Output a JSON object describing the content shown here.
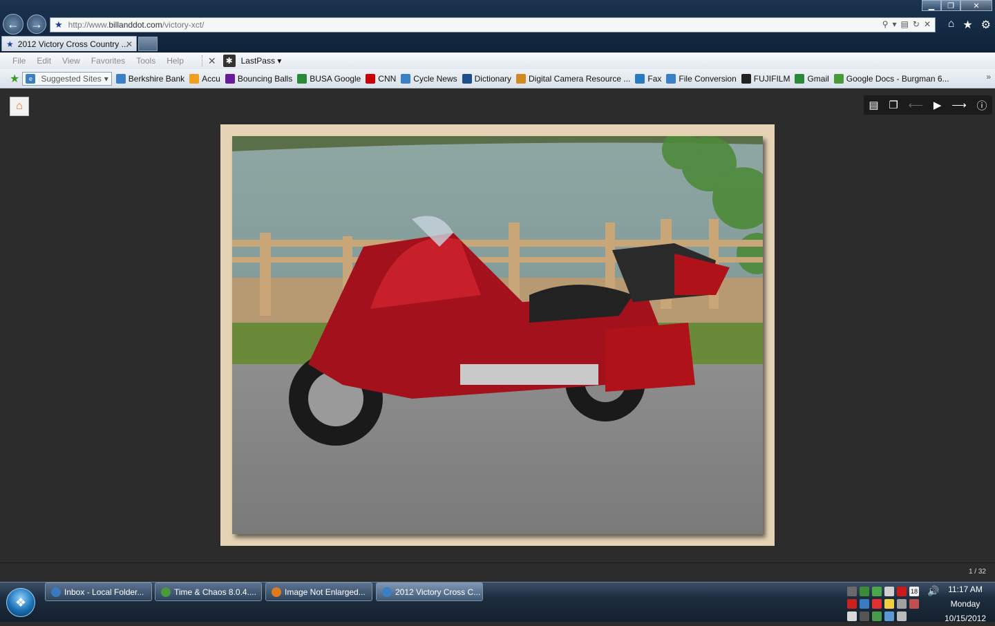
{
  "window": {
    "minimize_label": "▁",
    "restore_label": "❐",
    "close_label": "✕"
  },
  "address": {
    "url_prefix": "http://www.",
    "url_domain": "billanddot.com",
    "url_path": "/victory-xct/"
  },
  "tab": {
    "title": "2012 Victory Cross Country ..."
  },
  "menu": {
    "items": [
      "File",
      "Edit",
      "View",
      "Favorites",
      "Tools",
      "Help"
    ],
    "lastpass": "LastPass"
  },
  "favorites": {
    "suggested": "Suggested Sites",
    "items": [
      {
        "label": "Berkshire Bank",
        "icon": "ie-page-icon",
        "color": "#3b7fc4"
      },
      {
        "label": "Accu",
        "icon": "sun-icon",
        "color": "#f0a020"
      },
      {
        "label": "Bouncing Balls",
        "icon": "yahoo-icon",
        "color": "#6a1b9a"
      },
      {
        "label": "BUSA Google",
        "icon": "google-icon",
        "color": "#2a8a3a"
      },
      {
        "label": "CNN",
        "icon": "cnn-icon",
        "color": "#cc0000"
      },
      {
        "label": "Cycle News",
        "icon": "ie-page-icon",
        "color": "#3b7fc4"
      },
      {
        "label": "Dictionary",
        "icon": "dictionary-icon",
        "color": "#1f4f8a"
      },
      {
        "label": "Digital Camera Resource ...",
        "icon": "gear-icon",
        "color": "#d08a20"
      },
      {
        "label": "Fax",
        "icon": "fax-icon",
        "color": "#2a7ac2"
      },
      {
        "label": "File Conversion",
        "icon": "file-icon",
        "color": "#3b7fc4"
      },
      {
        "label": "FUJIFILM",
        "icon": "fuji-icon",
        "color": "#222222"
      },
      {
        "label": "Gmail",
        "icon": "google-icon",
        "color": "#2a8a3a"
      },
      {
        "label": "Google Docs - Burgman 6...",
        "icon": "docs-icon",
        "color": "#4a9a3a"
      }
    ]
  },
  "viewer": {
    "counter": "1 / 32",
    "controls": [
      "thumbnails-icon",
      "fullscreen-icon",
      "prev-icon",
      "play-icon",
      "next-icon",
      "info-icon"
    ]
  },
  "taskbar": {
    "tasks": [
      {
        "label": "Inbox - Local Folder...",
        "color": "#3a78c0"
      },
      {
        "label": "Time & Chaos 8.0.4....",
        "color": "#4a9a3a"
      },
      {
        "label": "Image Not Enlarged...",
        "color": "#e07a20"
      },
      {
        "label": "2012 Victory Cross C...",
        "color": "#3b7fc4"
      }
    ],
    "tray_badge": "18",
    "clock": {
      "time": "11:17 AM",
      "day": "Monday",
      "date": "10/15/2012"
    }
  }
}
